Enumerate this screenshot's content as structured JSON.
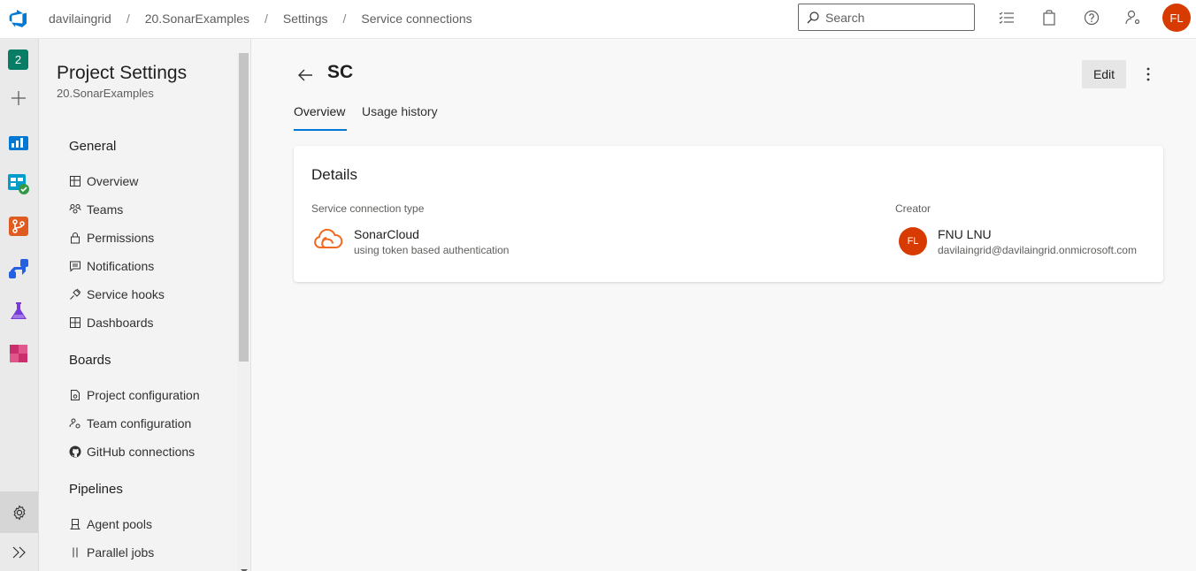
{
  "header": {
    "breadcrumbs": [
      "davilaingrid",
      "20.SonarExamples",
      "Settings",
      "Service connections"
    ],
    "separator": "/",
    "search_placeholder": "Search",
    "user_initials": "FL"
  },
  "rail": {
    "project_badge": "2"
  },
  "nav": {
    "title": "Project Settings",
    "subtitle": "20.SonarExamples",
    "sections": [
      {
        "label": "General",
        "items": [
          {
            "label": "Overview",
            "icon": "overview-icon"
          },
          {
            "label": "Teams",
            "icon": "teams-icon"
          },
          {
            "label": "Permissions",
            "icon": "lock-icon"
          },
          {
            "label": "Notifications",
            "icon": "notification-icon"
          },
          {
            "label": "Service hooks",
            "icon": "plug-icon"
          },
          {
            "label": "Dashboards",
            "icon": "dashboard-icon"
          }
        ]
      },
      {
        "label": "Boards",
        "items": [
          {
            "label": "Project configuration",
            "icon": "document-settings-icon"
          },
          {
            "label": "Team configuration",
            "icon": "team-settings-icon"
          },
          {
            "label": "GitHub connections",
            "icon": "github-icon"
          }
        ]
      },
      {
        "label": "Pipelines",
        "items": [
          {
            "label": "Agent pools",
            "icon": "agent-icon"
          },
          {
            "label": "Parallel jobs",
            "icon": "parallel-icon"
          }
        ]
      }
    ]
  },
  "main": {
    "title": "SC",
    "edit_label": "Edit",
    "tabs": [
      {
        "label": "Overview",
        "active": true
      },
      {
        "label": "Usage history",
        "active": false
      }
    ],
    "details": {
      "title": "Details",
      "type_label": "Service connection type",
      "type_name": "SonarCloud",
      "type_desc": "using token based authentication",
      "creator_label": "Creator",
      "creator_initials": "FL",
      "creator_name": "FNU LNU",
      "creator_email": "davilaingrid@davilaingrid.onmicrosoft.com"
    }
  },
  "colors": {
    "accent": "#0078d4",
    "avatar": "#d83b01",
    "sonar": "#f26a22"
  }
}
